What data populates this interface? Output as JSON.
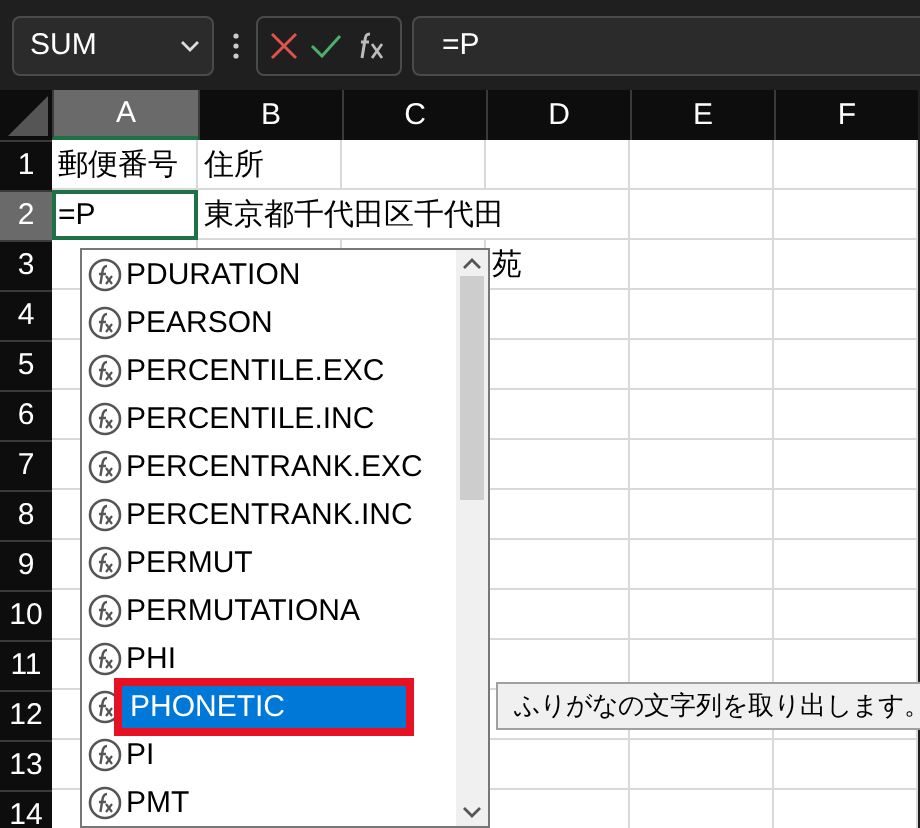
{
  "name_box": {
    "value": "SUM"
  },
  "formula_bar": {
    "value": "=P"
  },
  "columns": [
    {
      "label": "A",
      "selected": true
    },
    {
      "label": "B",
      "selected": false
    },
    {
      "label": "C",
      "selected": false
    },
    {
      "label": "D",
      "selected": false
    },
    {
      "label": "E",
      "selected": false
    },
    {
      "label": "F",
      "selected": false
    }
  ],
  "rows": [
    {
      "label": "1",
      "selected": false,
      "cells": {
        "A": "郵便番号",
        "B": "住所"
      }
    },
    {
      "label": "2",
      "selected": true,
      "cells": {
        "A": "=P",
        "B": "東京都千代田区千代田"
      }
    },
    {
      "label": "3",
      "selected": false,
      "cells": {
        "D": "苑"
      }
    },
    {
      "label": "4",
      "selected": false,
      "cells": {}
    },
    {
      "label": "5",
      "selected": false,
      "cells": {}
    },
    {
      "label": "6",
      "selected": false,
      "cells": {}
    },
    {
      "label": "7",
      "selected": false,
      "cells": {}
    },
    {
      "label": "8",
      "selected": false,
      "cells": {}
    },
    {
      "label": "9",
      "selected": false,
      "cells": {}
    },
    {
      "label": "10",
      "selected": false,
      "cells": {}
    },
    {
      "label": "11",
      "selected": false,
      "cells": {}
    },
    {
      "label": "12",
      "selected": false,
      "cells": {}
    },
    {
      "label": "13",
      "selected": false,
      "cells": {}
    },
    {
      "label": "14",
      "selected": false,
      "cells": {}
    }
  ],
  "autocomplete": {
    "items": [
      {
        "label": "PDURATION",
        "selected": false
      },
      {
        "label": "PEARSON",
        "selected": false
      },
      {
        "label": "PERCENTILE.EXC",
        "selected": false
      },
      {
        "label": "PERCENTILE.INC",
        "selected": false
      },
      {
        "label": "PERCENTRANK.EXC",
        "selected": false
      },
      {
        "label": "PERCENTRANK.INC",
        "selected": false
      },
      {
        "label": "PERMUT",
        "selected": false
      },
      {
        "label": "PERMUTATIONA",
        "selected": false
      },
      {
        "label": "PHI",
        "selected": false
      },
      {
        "label": "PHONETIC",
        "selected": true
      },
      {
        "label": "PI",
        "selected": false
      },
      {
        "label": "PMT",
        "selected": false
      }
    ],
    "tooltip": "ふりがなの文字列を取り出します。"
  }
}
